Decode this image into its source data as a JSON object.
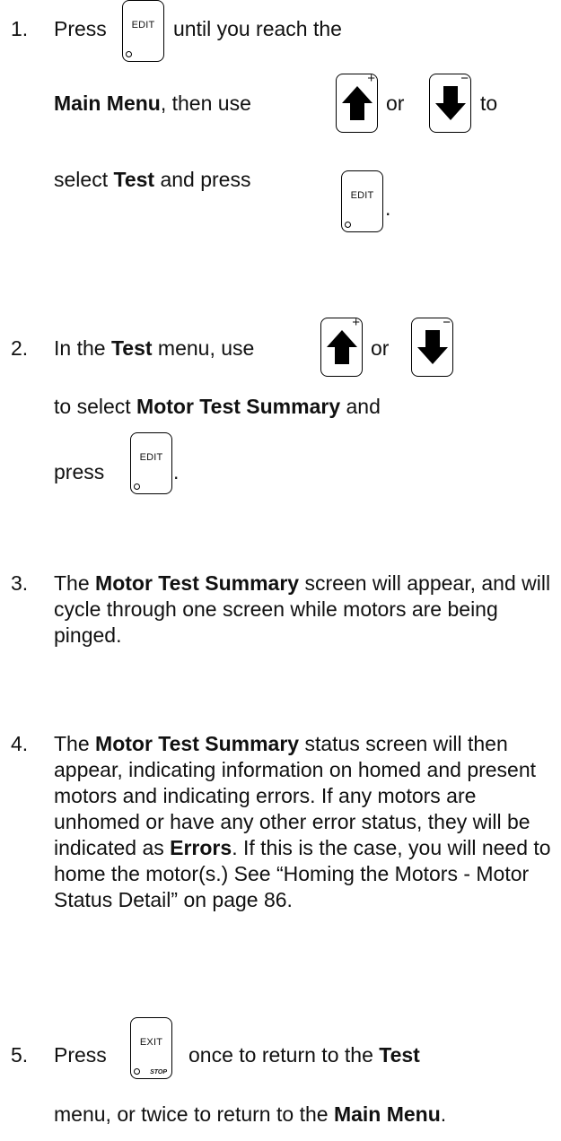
{
  "steps": [
    {
      "number": "1.",
      "line1_pre": "Press",
      "line1_post": "until you reach the",
      "line2_bold": "Main Menu",
      "line2_mid": ", then use",
      "line2_or": "or",
      "line2_to": "to",
      "line3_pre": "select",
      "line3_bold": "Test",
      "line3_post": "and press",
      "line3_end": "."
    },
    {
      "number": "2.",
      "line1_pre": "In the",
      "line1_bold": "Test",
      "line1_post": "menu, use",
      "line1_or": "or",
      "line2_pre": "to select",
      "line2_bold": "Motor Test Summary",
      "line2_post": "and",
      "line3_pre": "press",
      "line3_end": "."
    },
    {
      "number": "3.",
      "pre": "The",
      "bold": "Motor Test Summary",
      "post": "screen will appear, and will cycle through one screen while motors are being pinged."
    },
    {
      "number": "4.",
      "pre": "The",
      "bold": "Motor Test Summary",
      "post1": "status screen will then appear, indicating information on homed and present motors and indicating errors. If any motors are unhomed or have any other error status, they will be indicated as",
      "bold2": "Errors",
      "post2": ". If this is the case, you will need to home the motor(s.) See “Homing the Motors - Motor Status Detail” on page 86."
    },
    {
      "number": "5.",
      "line1_pre": "Press",
      "line1_post": "once to return to the",
      "line1_bold": "Test",
      "line2_pre": "menu, or twice to return to the",
      "line2_bold": "Main Menu",
      "line2_end": "."
    }
  ],
  "keys": {
    "edit_label": "EDIT",
    "exit_label": "EXIT",
    "stop_label": "STOP",
    "plus_sign": "+",
    "minus_sign": "−"
  },
  "icons": {
    "up": "up-arrow-icon",
    "down": "down-arrow-icon",
    "led": "led-indicator-icon"
  }
}
